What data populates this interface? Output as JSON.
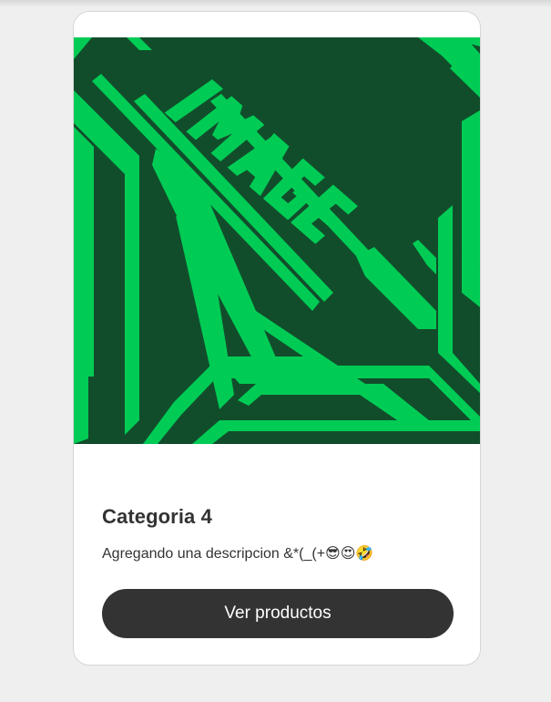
{
  "card": {
    "image": {
      "alt_text": "IMAGE",
      "colors": {
        "background": "#114d2b",
        "accent": "#00cc55"
      }
    },
    "title": "Categoria 4",
    "description": "Agregando una descripcion &*(_(+😎😍🤣",
    "button_label": "Ver productos",
    "colors": {
      "button_bg": "#333333",
      "button_text": "#ffffff",
      "text": "#333333",
      "page_bg": "#efefef"
    }
  }
}
